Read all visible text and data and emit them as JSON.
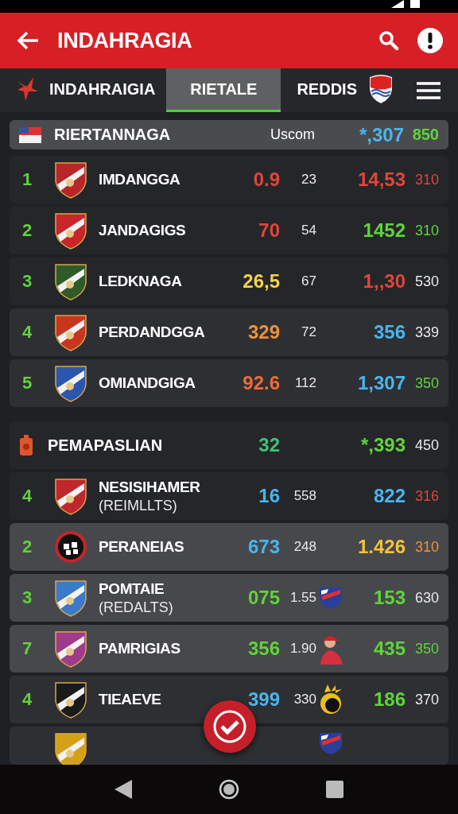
{
  "app_bar": {
    "title": "INDAHRAGIA"
  },
  "tabs": [
    {
      "label": "INDAHRAIGIA",
      "selected": false
    },
    {
      "label": "RIETALE",
      "selected": true
    },
    {
      "label": "REDDIS",
      "selected": false
    }
  ],
  "header": {
    "name": "RIERTANNAGA",
    "label": "Uscom",
    "stats": [
      {
        "text": "*,307",
        "color": "#4ab4ee"
      },
      {
        "text": "850",
        "color": "#5fd43a"
      }
    ]
  },
  "rows": [
    {
      "kind": "plain",
      "rank": "1",
      "name": "IMDANGGA",
      "crest": {
        "kind": "shield",
        "color": "#b8262a"
      },
      "stat_1": {
        "text": "0.9",
        "color": "#e0463a"
      },
      "stat_2": {
        "text": "23",
        "color": "#e8e8e8"
      },
      "stat_3": {
        "text": "14,53",
        "color": "#e0463a"
      },
      "stat_4": {
        "text": "310",
        "color": "#e0463a"
      }
    },
    {
      "kind": "plain",
      "rank": "2",
      "name": "JANDAGIGS",
      "crest": {
        "kind": "shield",
        "color": "#c8262a"
      },
      "stat_1": {
        "text": "70",
        "color": "#e0463a"
      },
      "stat_2": {
        "text": "54",
        "color": "#e8e8e8"
      },
      "stat_3": {
        "text": "1452",
        "color": "#5fd43a"
      },
      "stat_4": {
        "text": "310",
        "color": "#5fd43a"
      }
    },
    {
      "kind": "plain",
      "rank": "3",
      "name": "LEDKNAGA",
      "crest": {
        "kind": "shield",
        "color": "#2f5a2a"
      },
      "stat_1": {
        "text": "26,5",
        "color": "#f3d24a"
      },
      "stat_2": {
        "text": "67",
        "color": "#e8e8e8"
      },
      "stat_3": {
        "text": "1,,30",
        "color": "#e0463a"
      },
      "stat_4": {
        "text": "530",
        "color": "#e8e8e8"
      }
    },
    {
      "kind": "card",
      "rank": "4",
      "name": "PERDANDGGA",
      "crest": {
        "kind": "shield",
        "color": "#c8361e"
      },
      "stat_1": {
        "text": "329",
        "color": "#f0913a"
      },
      "stat_2": {
        "text": "72",
        "color": "#e8e8e8"
      },
      "stat_3": {
        "text": "356",
        "color": "#4ab4ee"
      },
      "stat_4": {
        "text": "339",
        "color": "#e8e8e8"
      }
    },
    {
      "kind": "card",
      "rank": "5",
      "name": "OMIANDGIGA",
      "crest": {
        "kind": "shield",
        "color": "#2a56b0"
      },
      "stat_1": {
        "text": "92.6",
        "color": "#ee6a3a"
      },
      "stat_2": {
        "text": "112",
        "color": "#e8e8e8"
      },
      "stat_3": {
        "text": "1,307",
        "color": "#4ab4ee"
      },
      "stat_4": {
        "text": "350",
        "color": "#5fd43a"
      }
    },
    {
      "kind": "section",
      "name": "PEMAPASLIAN",
      "stat_1": {
        "text": "32",
        "color": "#3ec27a"
      },
      "stat_3": {
        "text": "*,393",
        "color": "#5fd43a"
      },
      "stat_4": {
        "text": "450",
        "color": "#e8e8e8"
      }
    },
    {
      "kind": "plain",
      "rank": "4",
      "name": "NESISIHAMER",
      "subtitle": "(REIMLLTS)",
      "crest": {
        "kind": "shield",
        "color": "#c0272d"
      },
      "stat_1": {
        "text": "16",
        "color": "#4ab4ee"
      },
      "stat_2": {
        "text": "558",
        "color": "#e8e8e8"
      },
      "stat_3": {
        "text": "822",
        "color": "#4ab4ee"
      },
      "stat_4": {
        "text": "316",
        "color": "#e0463a"
      }
    },
    {
      "kind": "light",
      "rank": "2",
      "name": "PERANEIAS",
      "crest": {
        "kind": "round",
        "color": "#c0272d"
      },
      "stat_1": {
        "text": "673",
        "color": "#4ab4ee"
      },
      "stat_2": {
        "text": "248",
        "color": "#e8e8e8"
      },
      "stat_3": {
        "text": "1.426",
        "color": "#f2c23a"
      },
      "stat_4": {
        "text": "310",
        "color": "#f0913a"
      }
    },
    {
      "kind": "light",
      "rank": "3",
      "name": "POMTAIE",
      "subtitle": "(REDALTS)",
      "crest": {
        "kind": "shield",
        "color": "#3a7ac8"
      },
      "side_icon": {
        "kind": "flag"
      },
      "stat_1": {
        "text": "075",
        "color": "#5fd43a"
      },
      "stat_2": {
        "text": "1.55",
        "color": "#e8e8e8"
      },
      "stat_3": {
        "text": "153",
        "color": "#5fd43a"
      },
      "stat_4": {
        "text": "630",
        "color": "#e8e8e8"
      }
    },
    {
      "kind": "light",
      "rank": "7",
      "name": "PAMRIGIAS",
      "crest": {
        "kind": "shield",
        "color": "#a03a8a"
      },
      "side_icon": {
        "kind": "figure"
      },
      "stat_1": {
        "text": "356",
        "color": "#5fd43a"
      },
      "stat_2": {
        "text": "1.90",
        "color": "#e8e8e8"
      },
      "stat_3": {
        "text": "435",
        "color": "#5fd43a"
      },
      "stat_4": {
        "text": "350",
        "color": "#5fd43a"
      }
    },
    {
      "kind": "card",
      "rank": "4",
      "name": "TIEAEVE",
      "crest": {
        "kind": "shield",
        "color": "#1a1a1a"
      },
      "side_icon": {
        "kind": "bomb"
      },
      "stat_1": {
        "text": "399",
        "color": "#4ab4ee"
      },
      "stat_2": {
        "text": "330",
        "color": "#e8e8e8"
      },
      "stat_3": {
        "text": "186",
        "color": "#5fd43a"
      },
      "stat_4": {
        "text": "370",
        "color": "#e8e8e8"
      }
    },
    {
      "kind": "cut",
      "crest": {
        "kind": "shield",
        "color": "#d4a017"
      },
      "side_icon": {
        "kind": "flag"
      }
    }
  ]
}
